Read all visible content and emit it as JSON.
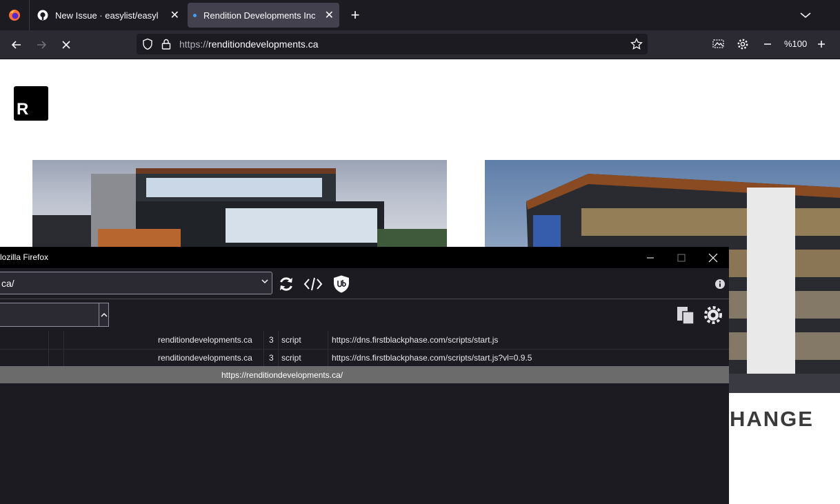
{
  "browser": {
    "tabs": [
      {
        "title": "New Issue · easylist/easylist",
        "icon": "github-icon"
      },
      {
        "title": "Rendition Developments Inc. – |",
        "icon": "loading-dot-icon",
        "active": true
      }
    ],
    "url": {
      "scheme": "https://",
      "host": "renditiondevelopments.ca"
    },
    "zoom": "%100",
    "colors": {
      "chrome_dark": "#1c1b22",
      "toolbar": "#2b2a33",
      "active_tab": "#42414d"
    }
  },
  "page": {
    "logo_letter": "R",
    "headline_fragment": "HANGE"
  },
  "logger": {
    "window_title": "lozilla Firefox",
    "tab_select_value": "ca/",
    "rows": [
      {
        "domain": "renditiondevelopments.ca",
        "party": "3",
        "type": "script",
        "url": "https://dns.firstblackphase.com/scripts/start.js"
      },
      {
        "domain": "renditiondevelopments.ca",
        "party": "3",
        "type": "script",
        "url": "https://dns.firstblackphase.com/scripts/start.js?vl=0.9.5"
      }
    ],
    "page_row_url": "https://renditiondevelopments.ca/"
  }
}
